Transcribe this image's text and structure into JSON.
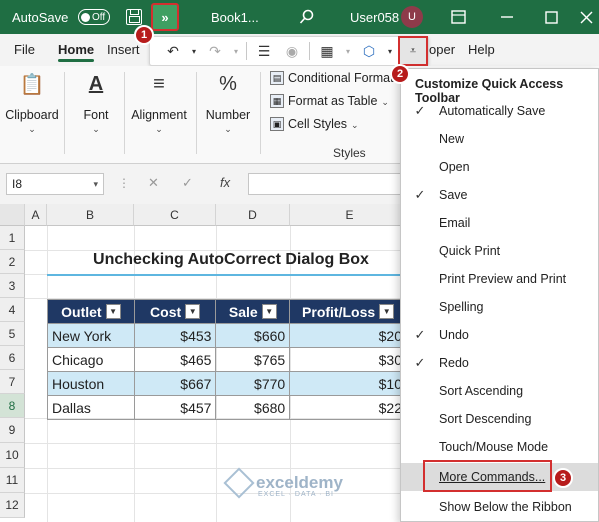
{
  "titlebar": {
    "autosave_label": "AutoSave",
    "autosave_state": "Off",
    "more_label": "»",
    "book_title": "Book1...",
    "user": "User058",
    "avatar_initial": "U"
  },
  "tabs": [
    {
      "label": "File"
    },
    {
      "label": "Home"
    },
    {
      "label": "Insert"
    },
    {
      "label": "oper"
    },
    {
      "label": "Help"
    }
  ],
  "ribbon": {
    "clipboard": "Clipboard",
    "font": "Font",
    "alignment": "Alignment",
    "number": "Number",
    "conditional_formatting": "Conditional Formatt",
    "format_as_table": "Format as Table",
    "cell_styles": "Cell Styles",
    "styles_group": "Styles"
  },
  "formula_bar": {
    "name_box": "I8",
    "fx": "fx"
  },
  "grid": {
    "columns": [
      "A",
      "B",
      "C",
      "D",
      "E"
    ],
    "rows": [
      "1",
      "2",
      "3",
      "4",
      "5",
      "6",
      "7",
      "8",
      "9",
      "10",
      "11",
      "12"
    ],
    "selected_row": "8"
  },
  "sheet": {
    "title": "Unchecking AutoCorrect Dialog Box",
    "headers": [
      "Outlet",
      "Cost",
      "Sale",
      "Profit/Loss"
    ],
    "rows": [
      [
        "New York",
        "$453",
        "$660",
        "$20"
      ],
      [
        "Chicago",
        "$465",
        "$765",
        "$30"
      ],
      [
        "Houston",
        "$667",
        "$770",
        "$10"
      ],
      [
        "Dallas",
        "$457",
        "$680",
        "$22"
      ]
    ]
  },
  "menu": {
    "title": "Customize Quick Access Toolbar",
    "items": [
      {
        "label": "Automatically Save",
        "checked": "✓"
      },
      {
        "label": "New",
        "checked": ""
      },
      {
        "label": "Open",
        "checked": ""
      },
      {
        "label": "Save",
        "checked": "✓"
      },
      {
        "label": "Email",
        "checked": ""
      },
      {
        "label": "Quick Print",
        "checked": ""
      },
      {
        "label": "Print Preview and Print",
        "checked": ""
      },
      {
        "label": "Spelling",
        "checked": ""
      },
      {
        "label": "Undo",
        "checked": "✓"
      },
      {
        "label": "Redo",
        "checked": "✓"
      },
      {
        "label": "Sort Ascending",
        "checked": ""
      },
      {
        "label": "Sort Descending",
        "checked": ""
      },
      {
        "label": "Touch/Mouse Mode",
        "checked": ""
      },
      {
        "label": "More Commands...",
        "checked": ""
      },
      {
        "label": "Show Below the Ribbon",
        "checked": ""
      }
    ]
  },
  "badges": {
    "one": "1",
    "two": "2",
    "three": "3"
  },
  "watermark": {
    "name": "exceldemy",
    "tagline": "EXCEL · DATA · BI"
  },
  "colors": {
    "excel_green": "#1f6e43",
    "header_navy": "#1f3864",
    "row_highlight": "#cfe9f6",
    "callout_red": "#d32f2f"
  }
}
